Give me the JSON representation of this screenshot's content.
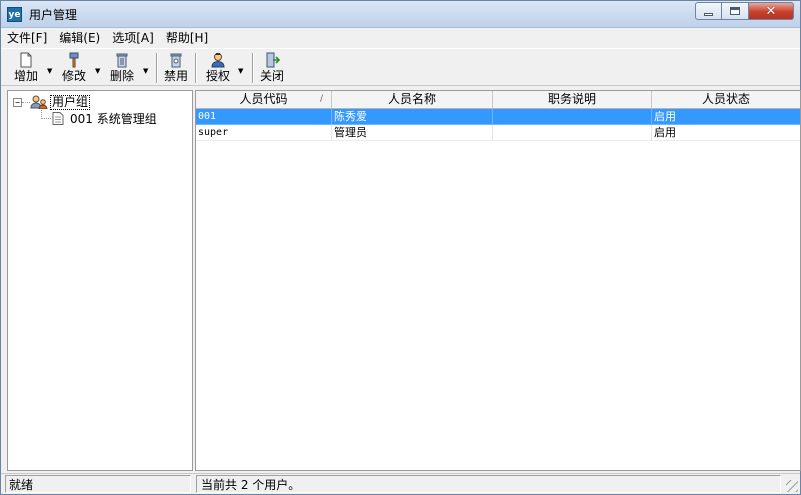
{
  "window": {
    "title": "用户管理",
    "app_icon_text": "ye"
  },
  "menu": [
    {
      "label": "文件[F]"
    },
    {
      "label": "编辑(E)"
    },
    {
      "label": "选项[A]"
    },
    {
      "label": "帮助[H]"
    }
  ],
  "toolbar": {
    "add_label": "增加",
    "edit_label": "修改",
    "delete_label": "删除",
    "disable_label": "禁用",
    "grant_label": "授权",
    "close_label": "关闭"
  },
  "tree": {
    "root_label": "用户组",
    "child_label": "001 系统管理组"
  },
  "grid": {
    "columns": [
      "人员代码",
      "人员名称",
      "职务说明",
      "人员状态"
    ],
    "sort_mark": "/",
    "rows": [
      {
        "code": "001",
        "name": "陈秀爱",
        "title": "",
        "status": "启用",
        "selected": true
      },
      {
        "code": "super",
        "name": "管理员",
        "title": "",
        "status": "启用",
        "selected": false
      }
    ]
  },
  "status": {
    "left": "就绪",
    "right": "当前共 2 个用户。"
  },
  "colors": {
    "selection": "#3399ff",
    "titlebar": "#c9d9ee",
    "close_button": "#c7402e"
  }
}
